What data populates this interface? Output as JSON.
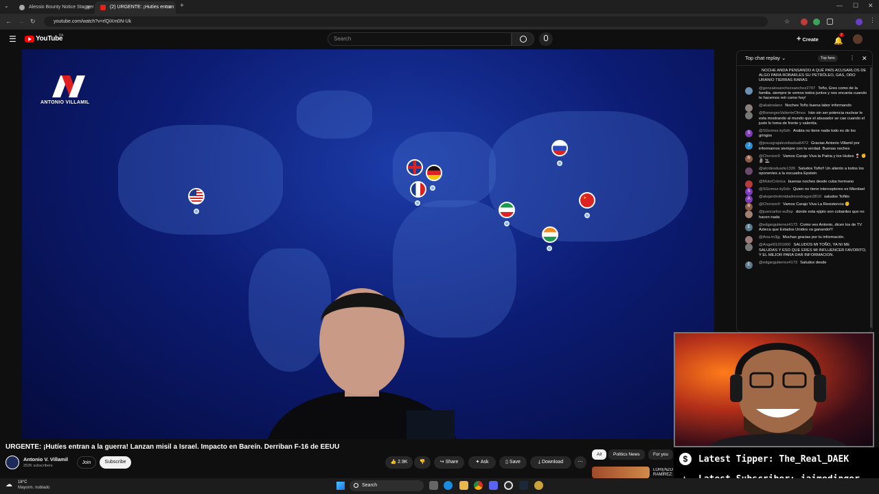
{
  "browser": {
    "tabs": [
      {
        "title": "Alessio Bounty Notice Stagger"
      },
      {
        "title": "(2) URGENTE: ¡Hutíes entran"
      }
    ],
    "url": "youtube.com/watch?v=rlQiXm0N-Uk"
  },
  "youtube": {
    "logo_text": "YouTube",
    "region": "PA",
    "search_placeholder": "Search",
    "create_label": "Create",
    "notif_count": "2"
  },
  "video": {
    "channel_logo_text": "ANTONIO VILLAMIL",
    "title": "URGENTE: ¡Hutíes entran a la guerra! Lanzan misil a Israel. Impacto en Bareín. Derriban F-16 de EEUU",
    "channel_name": "Antonio V. Villamil",
    "subscribers": "252K subscribers",
    "join_label": "Join",
    "subscribe_label": "Subscribe",
    "likes": "2.9K",
    "share_label": "Share",
    "ask_label": "Ask",
    "save_label": "Save",
    "download_label": "Download"
  },
  "chips": [
    "All",
    "Politics News",
    "For you"
  ],
  "related": {
    "title_fragment": "LORENZO RAMÍREZ: Lucha a muerte e"
  },
  "chat": {
    "header": "Top chat replay",
    "top_fans": "Top fans",
    "messages": [
      {
        "author": "",
        "text": "NOCHE ANDA PENSANDO A QUÉ PAÍS ACUSARLOS DE ALGO PARA ROBARLES SU PETRÓLEO, GAS, ORO URANIO TIERRAS RARAS",
        "color": "#0f0f0f",
        "initial": ""
      },
      {
        "author": "@gonzalosanchezsanchez2707",
        "text": "Toño, Eres como de la familia. siempre te vemos todos juntos y nos encanta cuando te hacemos reír como hoy!",
        "color": "#6a8fb0",
        "initial": ""
      },
      {
        "author": "@akabralanx",
        "text": "Noches Toño buena labor informando",
        "color": "#8a7f7a",
        "initial": ""
      },
      {
        "author": "@BonergesValienteOlmos",
        "text": "Irán sin ser potencia nuclear le esta mostrando al mundo que el abusador se cae cuando el justo lo toma de frente y valentía.",
        "color": "#777",
        "initial": ""
      },
      {
        "author": "@SGomez-ky5dn",
        "text": "Arabia no tiene nada todo es de los gringos",
        "color": "#7e3bb8",
        "initial": "S"
      },
      {
        "author": "@jesusgrajalezebadua5472",
        "text": "Gracias Antonio Villamil por informarnos siempre con la verdad. Buenas noches",
        "color": "#2a8fd6",
        "initial": "J"
      },
      {
        "author": "@Chorizer0",
        "text": "Vamos Carajo Viva la Patria y los Huties 🍷 ✊ 🗿 🚬",
        "color": "#8a5a4a",
        "initial": "R"
      },
      {
        "author": "@alcidesduarte1326",
        "text": "Saludos Toño!! Un aliento a todos los oponentes a la escuadra Epstein",
        "color": "#6a4a6a",
        "initial": ""
      },
      {
        "author": "@MotoCrónica",
        "text": "buenas noches desde cuba hermano",
        "color": "#b83a3a",
        "initial": ""
      },
      {
        "author": "@SGomez-ky5dn",
        "text": "Quien no tiene interceptores es Mierdael",
        "color": "#7e3bb8",
        "initial": "S"
      },
      {
        "author": "@alejandrotrinidadmondragon2810",
        "text": "saludos Toñito",
        "color": "#7e3bb8",
        "initial": "A"
      },
      {
        "author": "@Chorizer0",
        "text": "Vamos Carajo Viva La Resistencia ✊",
        "color": "#8a5a4a",
        "initial": "R"
      },
      {
        "author": "@juancarlos-su8sp",
        "text": "donde esta ejipto son cobardes que no hacen nada",
        "color": "#a08070",
        "initial": ""
      },
      {
        "author": "@edgargutierrez4173",
        "text": "Como ves Antonio, dicen los de TV Azteca que Estados Unidos va ganando!!!",
        "color": "#5b7a8a",
        "initial": "E"
      },
      {
        "author": "@Ana-tn3jg",
        "text": "Muchas gracias por tu información.",
        "color": "#9a7a7a",
        "initial": ""
      },
      {
        "author": "@Angel01201600",
        "text": "SALUDOS MI TOÑO, YA NI ME SALUDAS Y ESO QUE ERES MI INFLUENCER FAVORITO, Y EL MEJOR PARA DAR INFORMACION.",
        "color": "#777",
        "initial": ""
      },
      {
        "author": "@edgargutierrez4173",
        "text": "Saludos desde",
        "color": "#5b7a8a",
        "initial": "E"
      }
    ]
  },
  "overlay": {
    "latest_tipper": "Latest Tipper: The_Real_DAEK",
    "latest_subscriber": "Latest Subscriber: jaimedinger"
  },
  "taskbar": {
    "temperature": "18°C",
    "weather": "Mayorm. nublado",
    "search_label": "Search"
  }
}
